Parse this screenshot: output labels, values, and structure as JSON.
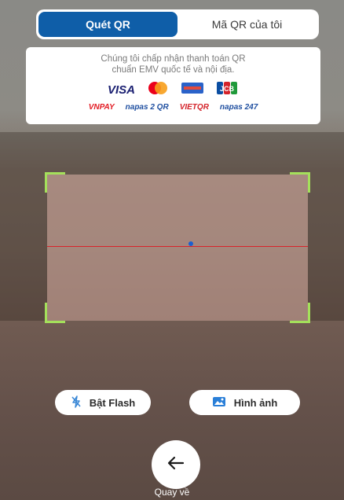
{
  "tabs": [
    {
      "label": "Quét QR",
      "active": true
    },
    {
      "label": "Mã QR của tôi",
      "active": false
    }
  ],
  "notice": {
    "line1": "Chúng tôi chấp nhận thanh toán QR",
    "line2": "chuẩn EMV quốc tế và nội địa."
  },
  "logos_row1": [
    {
      "label": "VISA",
      "color": "#1a1f71"
    },
    {
      "label": "",
      "icon": "mastercard-icon"
    },
    {
      "label": "",
      "icon": "amex-icon"
    },
    {
      "label": "JCB",
      "color": "#0b4ea2"
    }
  ],
  "logos_row2": [
    {
      "label": "VNPAY",
      "color": "#e21b23"
    },
    {
      "label": "napas 2 QR",
      "color": "#1f4fa0"
    },
    {
      "label": "VIETQR",
      "color": "#d4232a"
    },
    {
      "label": "napas 247",
      "color": "#1f4fa0"
    }
  ],
  "actions": {
    "flash_label": "Bật Flash",
    "image_label": "Hình ảnh"
  },
  "back_label": "Quay về",
  "colors": {
    "accent": "#0f5ea8",
    "scan_corner": "#a4e05b",
    "scan_line": "#d9242b"
  }
}
